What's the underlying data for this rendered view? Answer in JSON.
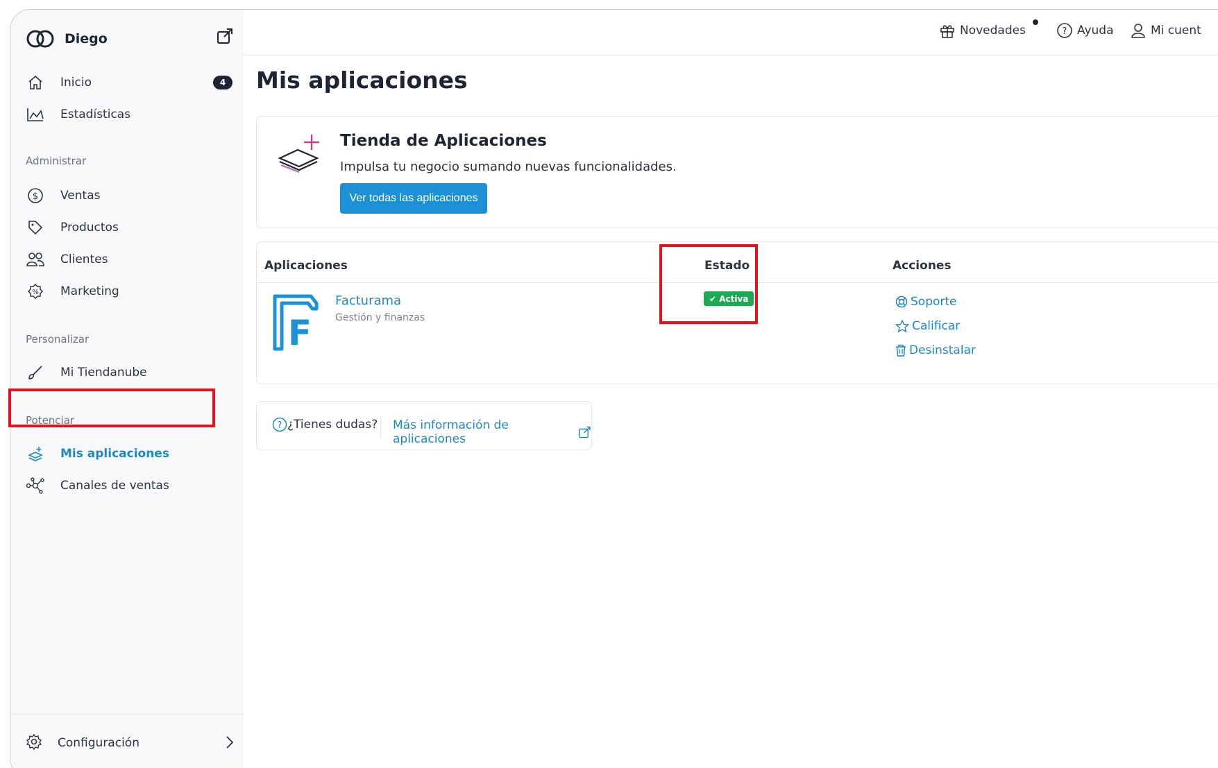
{
  "sidebar": {
    "store_name": "Diego",
    "items": [
      {
        "label": "Inicio",
        "icon": "home-icon",
        "badge": "4"
      },
      {
        "label": "Estadísticas",
        "icon": "chart-icon"
      },
      {
        "label": "Ventas",
        "icon": "dollar-icon"
      },
      {
        "label": "Productos",
        "icon": "tag-icon"
      },
      {
        "label": "Clientes",
        "icon": "users-icon"
      },
      {
        "label": "Marketing",
        "icon": "discount-icon"
      },
      {
        "label": "Mi Tiendanube",
        "icon": "brush-icon"
      },
      {
        "label": "Mis aplicaciones",
        "icon": "apps-icon",
        "active": true
      },
      {
        "label": "Canales de ventas",
        "icon": "network-icon"
      }
    ],
    "sections": {
      "administrar": "Administrar",
      "personalizar": "Personalizar",
      "potenciar": "Potenciar"
    },
    "footer": {
      "label": "Configuración",
      "icon": "gear-icon"
    }
  },
  "topbar": {
    "novedades": "Novedades",
    "ayuda": "Ayuda",
    "cuenta": "Mi cuent"
  },
  "main": {
    "title": "Mis aplicaciones",
    "store": {
      "title": "Tienda de Aplicaciones",
      "subtitle": "Impulsa tu negocio sumando nuevas funcionalidades.",
      "button": "Ver todas las aplicaciones"
    },
    "table": {
      "headers": [
        "Aplicaciones",
        "Estado",
        "Acciones"
      ],
      "rows": [
        {
          "name": "Facturama",
          "category": "Gestión y finanzas",
          "status": "✔ Activa",
          "actions": [
            "Soporte",
            "Calificar",
            "Desinstalar"
          ]
        }
      ]
    },
    "help": {
      "question": "¿Tienes dudas?",
      "link": "Más información de aplicaciones"
    }
  },
  "colors": {
    "accent": "#1e91d6",
    "active_status": "#1eaa55",
    "highlight": "#e8101a"
  }
}
